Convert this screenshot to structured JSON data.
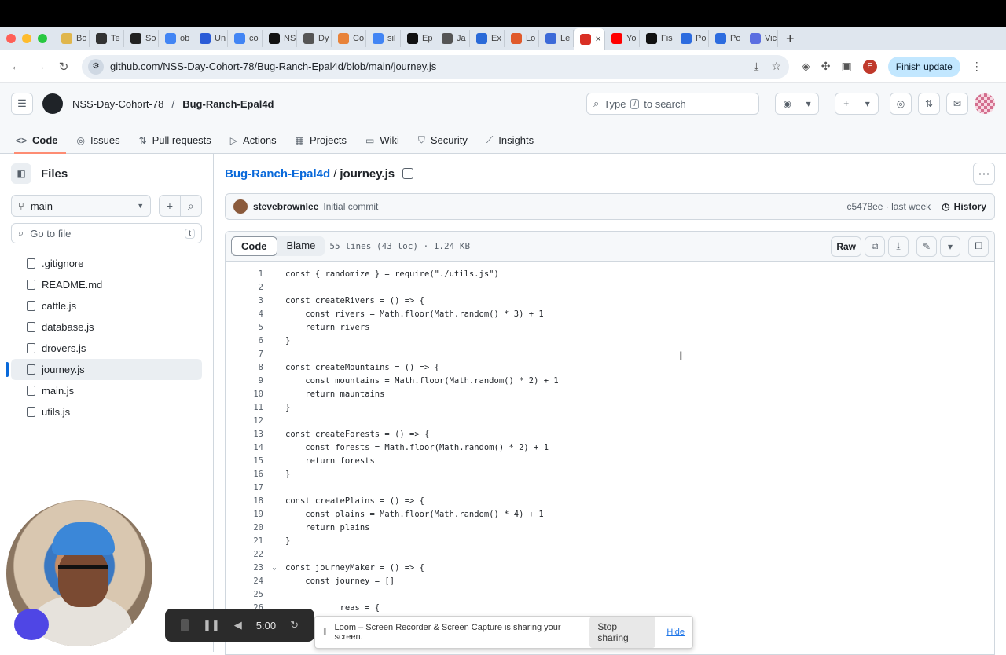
{
  "browser": {
    "tabs": [
      {
        "label": "Bo",
        "color": "#e0b64c"
      },
      {
        "label": "Te",
        "color": "#333333"
      },
      {
        "label": "So",
        "color": "#222222"
      },
      {
        "label": "ob",
        "color": "#4285f4"
      },
      {
        "label": "Un",
        "color": "#2a5bd7"
      },
      {
        "label": "co",
        "color": "#4285f4"
      },
      {
        "label": "NS",
        "color": "#111111"
      },
      {
        "label": "Dy",
        "color": "#555555"
      },
      {
        "label": "Co",
        "color": "#e8833a"
      },
      {
        "label": "sil",
        "color": "#4285f4"
      },
      {
        "label": "Ep",
        "color": "#111111"
      },
      {
        "label": "Ja",
        "color": "#555555"
      },
      {
        "label": "Ex",
        "color": "#2a6ad8"
      },
      {
        "label": "Lo",
        "color": "#e05a2b"
      },
      {
        "label": "Le",
        "color": "#3c6ad8"
      },
      {
        "label": "",
        "color": "#d93025",
        "active": true
      },
      {
        "label": "Yo",
        "color": "#ff0000"
      },
      {
        "label": "Fis",
        "color": "#111111"
      },
      {
        "label": "Po",
        "color": "#2d6cdf"
      },
      {
        "label": "Po",
        "color": "#2d6cdf"
      },
      {
        "label": "Vic",
        "color": "#5b6ee1"
      }
    ],
    "url": "github.com/NSS-Day-Cohort-78/Bug-Ranch-Epal4d/blob/main/journey.js",
    "profile_initial": "E",
    "finish_update": "Finish update"
  },
  "header": {
    "org": "NSS-Day-Cohort-78",
    "separator": "/",
    "repo": "Bug-Ranch-Epal4d",
    "search_prefix": "Type",
    "search_key": "/",
    "search_suffix": "to search"
  },
  "nav_tabs": [
    {
      "label": "Code",
      "icon": "<>",
      "selected": true
    },
    {
      "label": "Issues",
      "icon": "◎"
    },
    {
      "label": "Pull requests",
      "icon": "⇅"
    },
    {
      "label": "Actions",
      "icon": "▷"
    },
    {
      "label": "Projects",
      "icon": "▦"
    },
    {
      "label": "Wiki",
      "icon": "▭"
    },
    {
      "label": "Security",
      "icon": "⛉"
    },
    {
      "label": "Insights",
      "icon": "⟋"
    }
  ],
  "sidebar": {
    "title": "Files",
    "branch": "main",
    "goto_placeholder": "Go to file",
    "goto_key": "t",
    "files": [
      ".gitignore",
      "README.md",
      "cattle.js",
      "database.js",
      "drovers.js",
      "journey.js",
      "main.js",
      "utils.js"
    ],
    "active_file": "journey.js"
  },
  "file": {
    "repo": "Bug-Ranch-Epal4d",
    "separator": "/",
    "name": "journey.js",
    "commit_author": "stevebrownlee",
    "commit_message": "Initial commit",
    "commit_meta": "c5478ee · last week",
    "history": "History",
    "tab_code": "Code",
    "tab_blame": "Blame",
    "meta": "55 lines (43 loc) · 1.24 KB",
    "raw": "Raw"
  },
  "code_lines": [
    {
      "n": "1",
      "t": "const { randomize } = require(\"./utils.js\")"
    },
    {
      "n": "2",
      "t": ""
    },
    {
      "n": "3",
      "t": "const createRivers = () => {"
    },
    {
      "n": "4",
      "t": "    const rivers = Math.floor(Math.random() * 3) + 1"
    },
    {
      "n": "5",
      "t": "    return rivers"
    },
    {
      "n": "6",
      "t": "}"
    },
    {
      "n": "7",
      "t": ""
    },
    {
      "n": "8",
      "t": "const createMountains = () => {"
    },
    {
      "n": "9",
      "t": "    const mountains = Math.floor(Math.random() * 2) + 1"
    },
    {
      "n": "10",
      "t": "    return mauntains"
    },
    {
      "n": "11",
      "t": "}"
    },
    {
      "n": "12",
      "t": ""
    },
    {
      "n": "13",
      "t": "const createForests = () => {"
    },
    {
      "n": "14",
      "t": "    const forests = Math.floor(Math.random() * 2) + 1"
    },
    {
      "n": "15",
      "t": "    return forests"
    },
    {
      "n": "16",
      "t": "}"
    },
    {
      "n": "17",
      "t": ""
    },
    {
      "n": "18",
      "t": "const createPlains = () => {"
    },
    {
      "n": "19",
      "t": "    const plains = Math.floor(Math.random() * 4) + 1"
    },
    {
      "n": "20",
      "t": "    return plains"
    },
    {
      "n": "21",
      "t": "}"
    },
    {
      "n": "22",
      "t": ""
    },
    {
      "n": "23",
      "t": "const journeyMaker = () => {",
      "fold": true
    },
    {
      "n": "24",
      "t": "    const journey = []"
    },
    {
      "n": "25",
      "t": ""
    },
    {
      "n": "26",
      "t": "           reas = {"
    }
  ],
  "recorder": {
    "time": "5:00",
    "share_text": "Loom – Screen Recorder & Screen Capture is sharing your screen.",
    "stop_sharing": "Stop sharing",
    "hide": "Hide"
  }
}
